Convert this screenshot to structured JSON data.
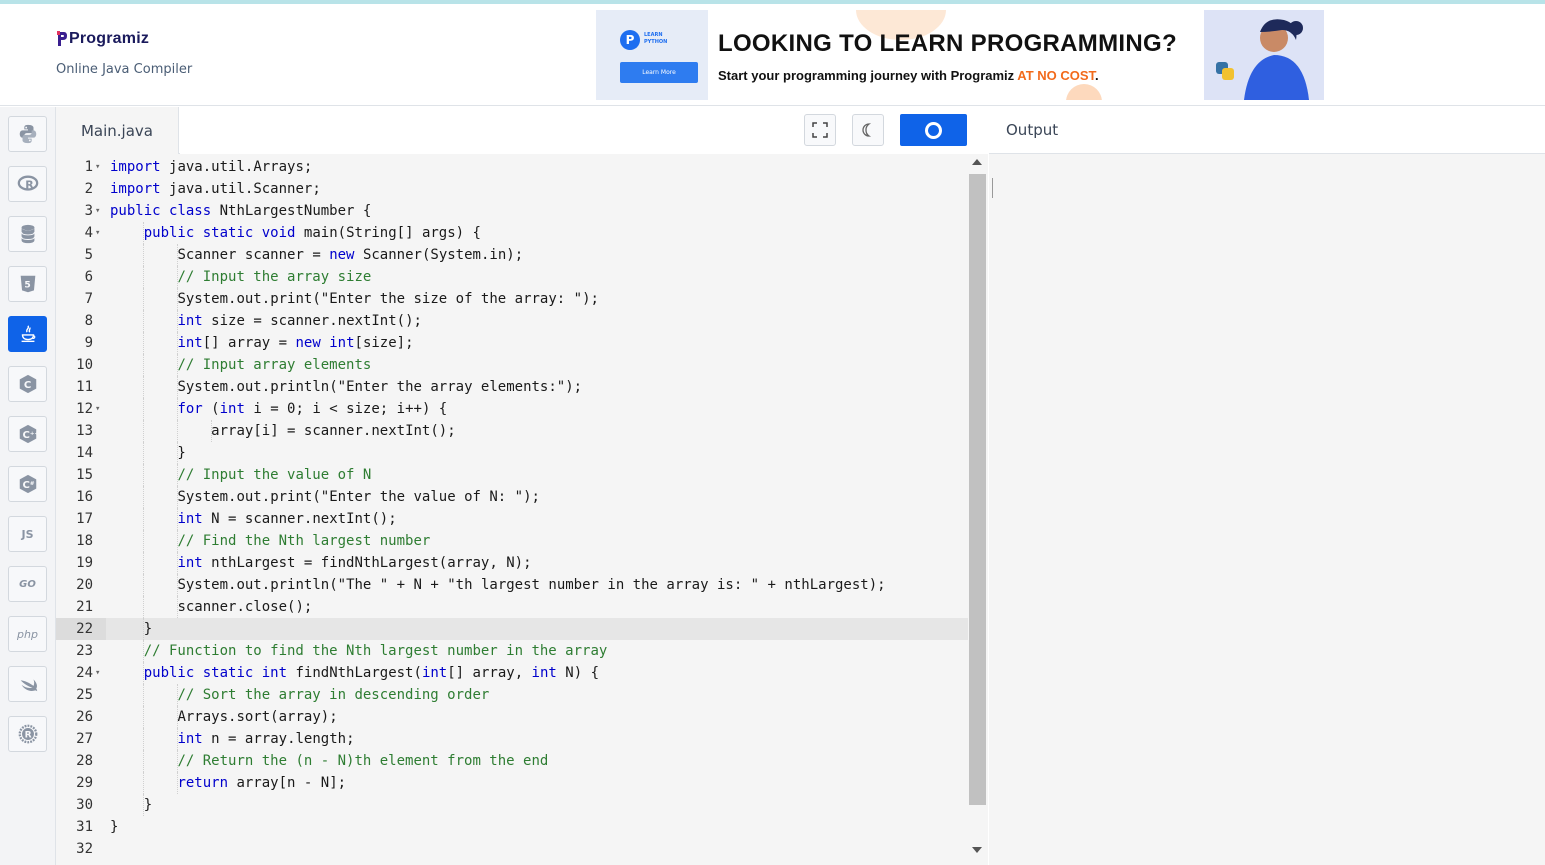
{
  "header": {
    "logo_text": "Programiz",
    "subtitle": "Online Java Compiler"
  },
  "ad": {
    "badge_line1": "LEARN",
    "badge_line2": "PYTHON",
    "button_label": "Learn More",
    "title": "LOOKING TO LEARN PROGRAMMING?",
    "subtitle_prefix": "Start your programming journey with Programiz ",
    "subtitle_highlight": "AT NO COST",
    "subtitle_suffix": "."
  },
  "sidebar": {
    "languages": [
      {
        "name": "python",
        "label": ""
      },
      {
        "name": "r",
        "label": "R"
      },
      {
        "name": "sql",
        "label": ""
      },
      {
        "name": "html",
        "label": "5"
      },
      {
        "name": "java",
        "label": ""
      },
      {
        "name": "c",
        "label": "C"
      },
      {
        "name": "cpp",
        "label": "C"
      },
      {
        "name": "csharp",
        "label": "C"
      },
      {
        "name": "js",
        "label": "JS"
      },
      {
        "name": "go",
        "label": "GO"
      },
      {
        "name": "php",
        "label": "php"
      },
      {
        "name": "swift",
        "label": ""
      },
      {
        "name": "rust",
        "label": "R"
      }
    ],
    "active": "java"
  },
  "editor": {
    "tab_label": "Main.java",
    "active_line": 22,
    "lines": [
      "import java.util.Arrays;",
      "import java.util.Scanner;",
      "public class NthLargestNumber {",
      "    public static void main(String[] args) {",
      "        Scanner scanner = new Scanner(System.in);",
      "        // Input the array size",
      "        System.out.print(\"Enter the size of the array: \");",
      "        int size = scanner.nextInt();",
      "        int[] array = new int[size];",
      "        // Input array elements",
      "        System.out.println(\"Enter the array elements:\");",
      "        for (int i = 0; i < size; i++) {",
      "            array[i] = scanner.nextInt();",
      "        }",
      "        // Input the value of N",
      "        System.out.print(\"Enter the value of N: \");",
      "        int N = scanner.nextInt();",
      "        // Find the Nth largest number",
      "        int nthLargest = findNthLargest(array, N);",
      "        System.out.println(\"The \" + N + \"th largest number in the array is: \" + nthLargest);",
      "        scanner.close();",
      "    }",
      "    // Function to find the Nth largest number in the array",
      "    public static int findNthLargest(int[] array, int N) {",
      "        // Sort the array in descending order",
      "        Arrays.sort(array);",
      "        int n = array.length;",
      "        // Return the (n - N)th element from the end",
      "        return array[n - N];",
      "    }",
      "}",
      ""
    ],
    "fold_lines": [
      1,
      3,
      4,
      12,
      24
    ]
  },
  "output": {
    "title": "Output"
  }
}
